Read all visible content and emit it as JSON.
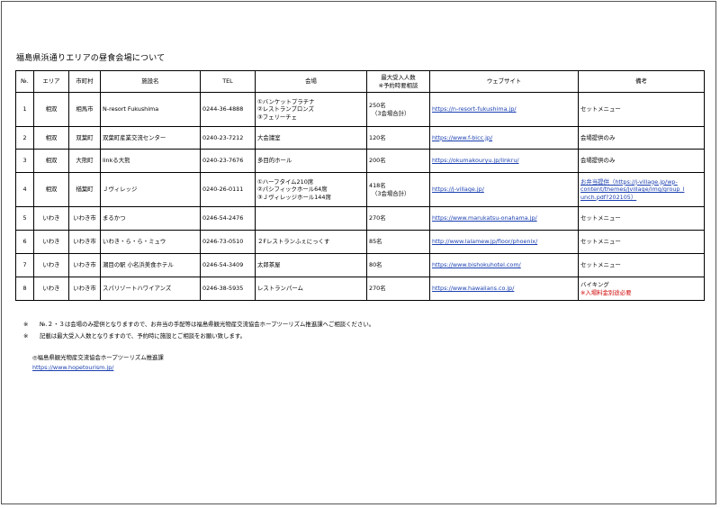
{
  "title": "福島県浜通りエリアの昼食会場について",
  "headers": [
    "№.",
    "エリア",
    "市町村",
    "施設名",
    "TEL",
    "会場",
    "最大受入人数",
    "※予約時要相談",
    "ウェブサイト",
    "備考"
  ],
  "rows": [
    {
      "no": "1",
      "area": "相双",
      "city": "相馬市",
      "name": "N-resort Fukushima",
      "tel": "0244-36-4888",
      "venue": [
        "①バンケットプラチナ",
        "②レストランブロンズ",
        "③フェリーチェ"
      ],
      "cap": [
        "250名",
        "（3会場合計）"
      ],
      "web": "https://n-resort-fukushima.jp/",
      "note": [
        "セットメニュー"
      ]
    },
    {
      "no": "2",
      "area": "相双",
      "city": "双葉町",
      "name": "双葉町産業交流センター",
      "tel": "0240-23-7212",
      "venue": [
        "大会議室"
      ],
      "cap": [
        "120名"
      ],
      "web": "https://www.f-bicc.jp/",
      "note": [
        "会場提供のみ"
      ]
    },
    {
      "no": "3",
      "area": "相双",
      "city": "大熊町",
      "name": "linkる大熊",
      "tel": "0240-23-7676",
      "venue": [
        "多目的ホール"
      ],
      "cap": [
        "200名"
      ],
      "web": "https://okumakouryu.jp/linkru/",
      "note": [
        "会場提供のみ"
      ]
    },
    {
      "no": "4",
      "area": "相双",
      "city": "楢葉町",
      "name": "Ｊヴィレッジ",
      "tel": "0240-26-0111",
      "venue": [
        "①ハーフタイム210席",
        "②パシフィックホール64席",
        "③Ｊヴィレッジホール144席"
      ],
      "cap": [
        "418名",
        "（3会場合計）"
      ],
      "web": "https://j-village.jp/",
      "note": [
        "お弁当提供（https://j-village.jp/wp-",
        "content/themes/jvillage/img/group_l",
        "unch.pdf?202105）"
      ]
    },
    {
      "no": "5",
      "area": "いわき",
      "city": "いわき市",
      "name": "まるかつ",
      "tel": "0246-54-2476",
      "venue": [
        ""
      ],
      "cap": [
        "270名"
      ],
      "web": "https://www.marukatsu-onahama.jp/",
      "note": [
        "セットメニュー"
      ]
    },
    {
      "no": "6",
      "area": "いわき",
      "city": "いわき市",
      "name": "いわき・ら・ら・ミュウ",
      "tel": "0246-73-0510",
      "venue": [
        "２Fレストランふぇにっくす"
      ],
      "cap": [
        "85名"
      ],
      "web": "http://www.lalamew.jp/floor/phoenix/",
      "note": [
        "セットメニュー"
      ]
    },
    {
      "no": "7",
      "area": "いわき",
      "city": "いわき市",
      "name": "潮目の駅 小名浜美食ホテル",
      "tel": "0246-54-3409",
      "venue": [
        "太郎茶屋"
      ],
      "cap": [
        "80名"
      ],
      "web": "https://www.bishokuhotel.com/",
      "note": [
        "セットメニュー"
      ]
    },
    {
      "no": "8",
      "area": "いわき",
      "city": "いわき市",
      "name": "スパリゾートハワイアンズ",
      "tel": "0246-38-5935",
      "venue": [
        "レストランパーム"
      ],
      "cap": [
        "270名"
      ],
      "web": "https://www.hawaiians.co.jp/",
      "note": [
        "バイキング"
      ],
      "note_red": "※入場料金別途必要"
    }
  ],
  "notes": [
    {
      "mark": "※",
      "text": "№.２・３は会場のみ提供となりますので、お弁当の手配等は福島県観光物産交流協会ホープツーリズム推進課へご相談ください。"
    },
    {
      "mark": "※",
      "text": "記載は最大受入人数となりますので、予約時に施設とご相談をお願い致します。"
    }
  ],
  "footer": {
    "org": "◎福島県観光物産交流協会ホープツーリズム推進課",
    "url": "https://www.hopetourism.jp/"
  },
  "colors": {
    "link": "#1a3fb0",
    "alert": "#d00000"
  }
}
